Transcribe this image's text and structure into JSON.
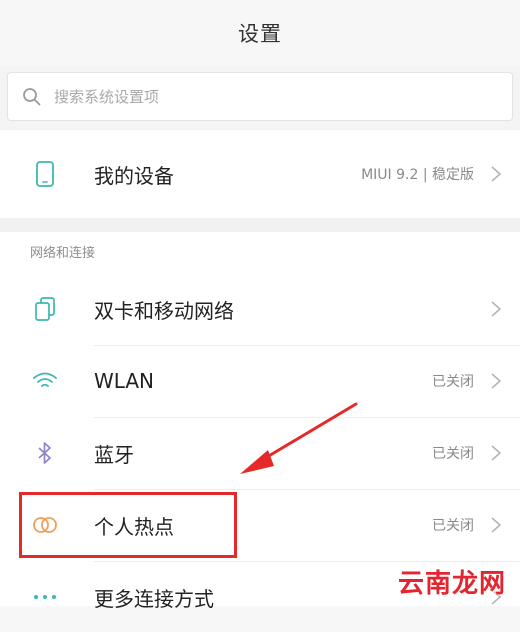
{
  "header": {
    "title": "设置"
  },
  "search": {
    "placeholder": "搜索系统设置项"
  },
  "device_row": {
    "label": "我的设备",
    "value": "MIUI 9.2 | 稳定版"
  },
  "section": {
    "title": "网络和连接"
  },
  "items": [
    {
      "label": "双卡和移动网络",
      "value": "",
      "icon": "dual-sim-icon"
    },
    {
      "label": "WLAN",
      "value": "已关闭",
      "icon": "wifi-icon"
    },
    {
      "label": "蓝牙",
      "value": "已关闭",
      "icon": "bluetooth-icon"
    },
    {
      "label": "个人热点",
      "value": "已关闭",
      "icon": "hotspot-icon"
    },
    {
      "label": "更多连接方式",
      "value": "",
      "icon": "more-icon"
    }
  ],
  "colors": {
    "annotation": "#e52828",
    "icon_teal": "#3cb8b0",
    "hotspot_orange": "#f0a05a"
  },
  "watermark": "云南龙网"
}
